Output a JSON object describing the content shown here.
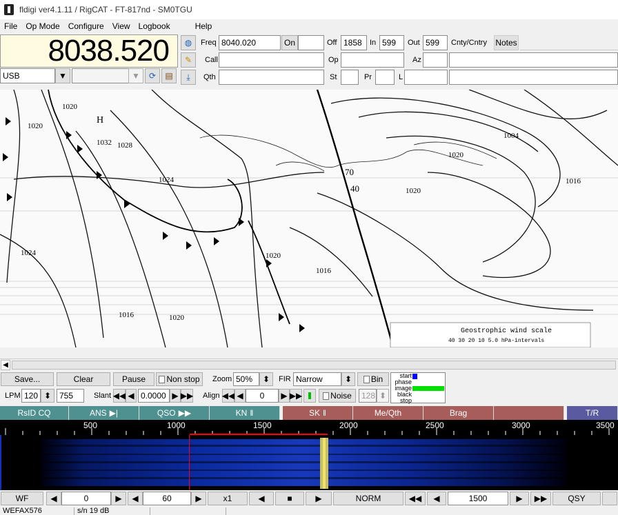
{
  "window": {
    "title": "fldigi ver4.1.11 / RigCAT - FT-817nd - SM0TGU"
  },
  "menu": [
    {
      "label": "File"
    },
    {
      "label": "Op Mode"
    },
    {
      "label": "Configure"
    },
    {
      "label": "View"
    },
    {
      "label": "Logbook"
    },
    {
      "label": "Help"
    }
  ],
  "rig": {
    "frequency": "8038.520",
    "mode": "USB",
    "bandwidth": ""
  },
  "log": {
    "freq_label": "Freq",
    "freq_value": "8040.020",
    "on_label": "On",
    "on_value": "",
    "off_label": "Off",
    "off_value": "1858",
    "in_label": "In",
    "in_value": "599",
    "out_label": "Out",
    "out_value": "599",
    "cnty_label": "Cnty/Cntry",
    "notes_label": "Notes",
    "call_label": "Call",
    "call_value": "",
    "op_label": "Op",
    "op_value": "",
    "az_label": "Az",
    "az_value": "",
    "qth_label": "Qth",
    "qth_value": "",
    "st_label": "St",
    "st_value": "",
    "pr_label": "Pr",
    "pr_value": "",
    "l_label": "L",
    "l_value": ""
  },
  "fax_image": {
    "labels": [
      "1020",
      "1020",
      "H",
      "1032",
      "1028",
      "1024",
      "1024",
      "1020",
      "1016",
      "1020",
      "1016",
      "1020",
      "70",
      "40",
      "1016",
      "1020",
      "1004",
      "Geostrophic wind scale",
      "40 30 20 10 5.0 hPa-intervals"
    ],
    "caption": "Geostrophic wind scale",
    "scale_text": "40 30 20 10 5.0 hPa-intervals"
  },
  "wefax": {
    "save_label": "Save...",
    "clear_label": "Clear",
    "pause_label": "Pause",
    "nonstop_label": "Non stop",
    "zoom_label": "Zoom",
    "zoom_value": "50%",
    "fir_label": "FIR",
    "fir_value": "Narrow",
    "bin_label": "Bin",
    "lpm_label": "LPM",
    "lpm_value": "120",
    "lpm_aux": "755",
    "slant_label": "Slant",
    "slant_value": "0.0000",
    "align_label": "Align",
    "align_value": "0",
    "noise_label": "Noise",
    "bin_value": "128",
    "state_labels": [
      "start",
      "phase",
      "image",
      "black",
      "stop"
    ]
  },
  "macros": [
    {
      "label": "RsID CQ",
      "color": "#4f9191"
    },
    {
      "label": "ANS",
      "color": "#4f9191"
    },
    {
      "label": "QSO",
      "color": "#4f9191"
    },
    {
      "label": "KN",
      "color": "#4f9191"
    },
    {
      "label": "SK",
      "color": "#a75e5a"
    },
    {
      "label": "Me/Qth",
      "color": "#a75e5a"
    },
    {
      "label": "Brag",
      "color": "#a75e5a"
    },
    {
      "label": "",
      "color": "#a75e5a"
    },
    {
      "label": "T/R",
      "color": "#5a5aa0"
    }
  ],
  "ruler": {
    "ticks": [
      "500",
      "1000",
      "1500",
      "2000",
      "2500",
      "3000",
      "3500"
    ]
  },
  "controls": {
    "wf_label": "WF",
    "offset_value": "0",
    "speed_value": "60",
    "zoom_label": "x1",
    "norm_label": "NORM",
    "carrier_value": "1500",
    "qsy_label": "QSY"
  },
  "status": {
    "mode": "WEFAX576",
    "snr": "s/n  19 dB",
    "extra": ""
  },
  "colors": {
    "freq_bg": "#fffbe0",
    "macro_teal": "#4f9191",
    "macro_red": "#a75e5a",
    "macro_blue": "#5a5aa0",
    "signal_marker": "#ff0000",
    "image_state": "#00e000",
    "start_state": "#0000ff"
  }
}
